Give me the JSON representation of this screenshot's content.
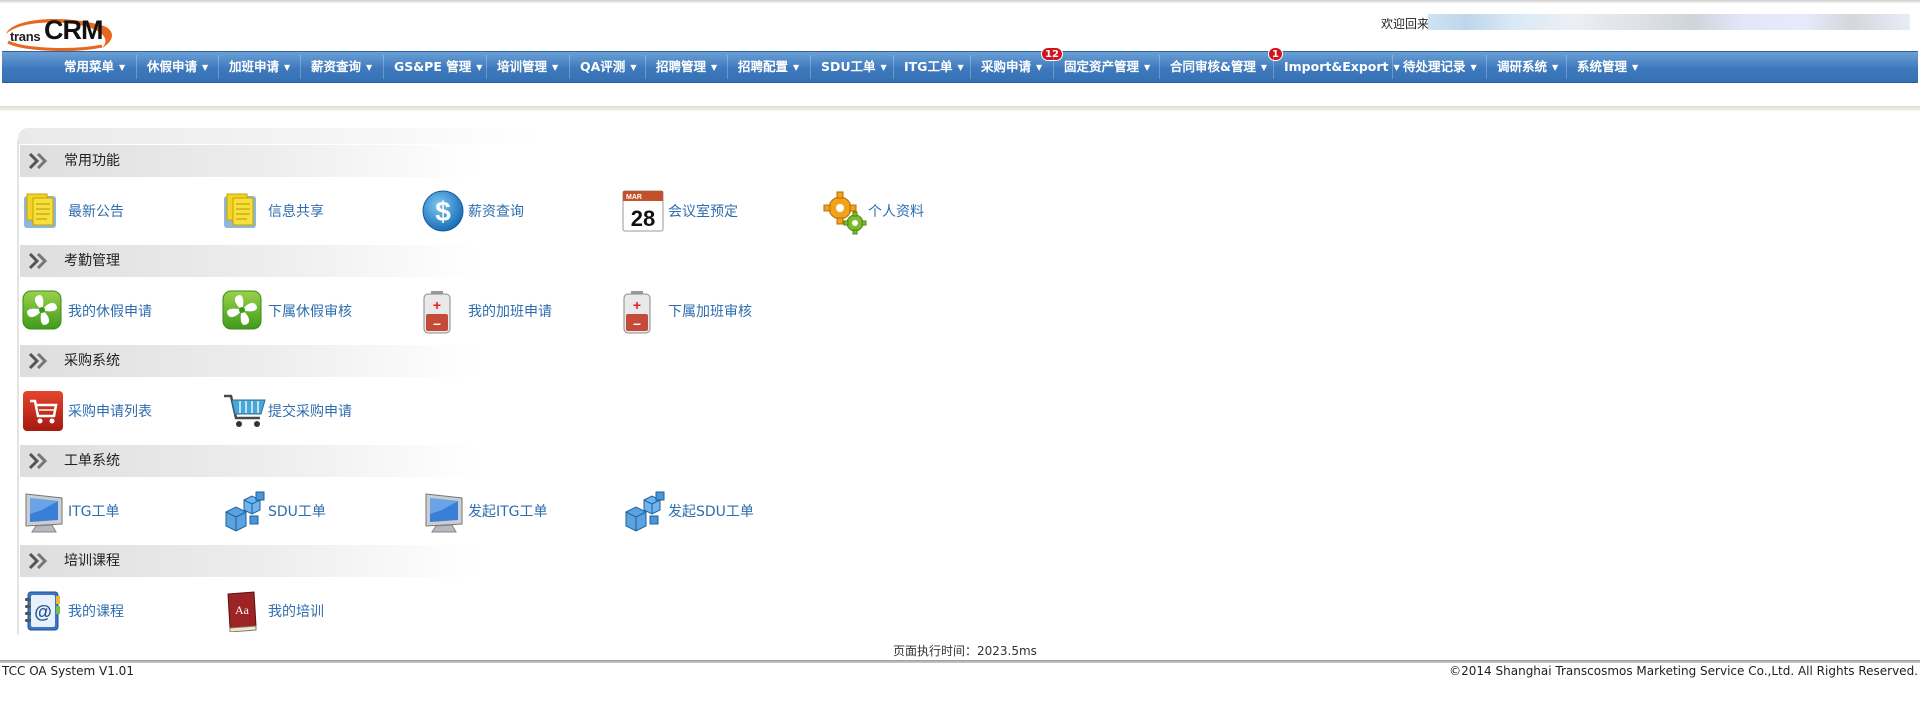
{
  "header": {
    "logo_trans": "trans",
    "logo_crm": "CRM",
    "welcome": "欢迎回来"
  },
  "nav": {
    "items": [
      {
        "label": "常用菜单"
      },
      {
        "label": "休假申请"
      },
      {
        "label": "加班申请"
      },
      {
        "label": "薪资查询"
      },
      {
        "label": "GS&PE 管理"
      },
      {
        "label": "培训管理"
      },
      {
        "label": "QA评测"
      },
      {
        "label": "招聘管理"
      },
      {
        "label": "招聘配置"
      },
      {
        "label": "SDU工单"
      },
      {
        "label": "ITG工单"
      },
      {
        "label": "采购申请",
        "badge": "12"
      },
      {
        "label": "固定资产管理"
      },
      {
        "label": "合同审核&管理",
        "badge": "1"
      },
      {
        "label": "Import&Export"
      },
      {
        "label": "待处理记录"
      },
      {
        "label": "调研系统"
      },
      {
        "label": "系统管理"
      }
    ]
  },
  "sections": [
    {
      "title": "常用功能",
      "items": [
        {
          "label": "最新公告",
          "icon": "notes-icon"
        },
        {
          "label": "信息共享",
          "icon": "notes-icon"
        },
        {
          "label": "薪资查询",
          "icon": "dollar-icon"
        },
        {
          "label": "会议室预定",
          "icon": "calendar-icon",
          "calendar_day": "28",
          "calendar_month": "MAR"
        },
        {
          "label": "个人资料",
          "icon": "gears-icon"
        }
      ]
    },
    {
      "title": "考勤管理",
      "items": [
        {
          "label": "我的休假申请",
          "icon": "fan-icon"
        },
        {
          "label": "下属休假审核",
          "icon": "fan-icon"
        },
        {
          "label": "我的加班申请",
          "icon": "battery-icon"
        },
        {
          "label": "下属加班审核",
          "icon": "battery-icon"
        }
      ]
    },
    {
      "title": "采购系统",
      "items": [
        {
          "label": "采购申请列表",
          "icon": "cart-red-icon"
        },
        {
          "label": "提交采购申请",
          "icon": "cart-icon"
        }
      ]
    },
    {
      "title": "工单系统",
      "items": [
        {
          "label": "ITG工单",
          "icon": "monitor-icon"
        },
        {
          "label": "SDU工单",
          "icon": "cubes-icon"
        },
        {
          "label": "发起ITG工单",
          "icon": "monitor-icon"
        },
        {
          "label": "发起SDU工单",
          "icon": "cubes-icon"
        }
      ]
    },
    {
      "title": "培训课程",
      "items": [
        {
          "label": "我的课程",
          "icon": "address-book-icon"
        },
        {
          "label": "我的培训",
          "icon": "dictionary-icon",
          "book_text": "Aa"
        }
      ]
    }
  ],
  "exec_time": "页面执行时间：2023.5ms",
  "footer": {
    "left": "TCC OA System V1.01",
    "right": "©2014 Shanghai Transcosmos Marketing Service Co.,Ltd. All Rights Reserved."
  },
  "colors": {
    "nav_blue": "#3f79bd",
    "link_blue": "#2e6db0",
    "badge_red": "#d0141d",
    "logo_orange": "#e8661e"
  }
}
